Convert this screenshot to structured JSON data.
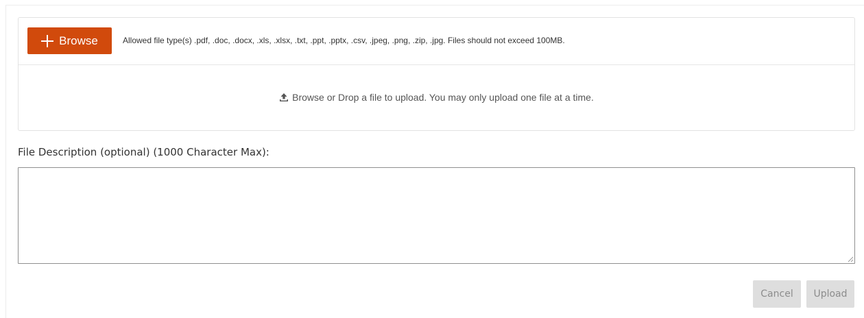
{
  "uploader": {
    "browse_label": "Browse",
    "allowed_text": "Allowed file type(s) .pdf, .doc, .docx, .xls, .xlsx, .txt, .ppt, .pptx, .csv, .jpeg, .png, .zip, .jpg. Files should not exceed 100MB.",
    "drop_text": "Browse or Drop a file to upload. You may only upload one file at a time."
  },
  "description": {
    "label": "File Description (optional) (1000 Character Max):",
    "value": ""
  },
  "actions": {
    "cancel_label": "Cancel",
    "upload_label": "Upload"
  },
  "colors": {
    "accent": "#d14a0c",
    "disabled_button": "#dedede"
  },
  "icons": {
    "browse": "plus-icon",
    "drop": "upload-icon",
    "textarea": "resize-grip-icon"
  }
}
